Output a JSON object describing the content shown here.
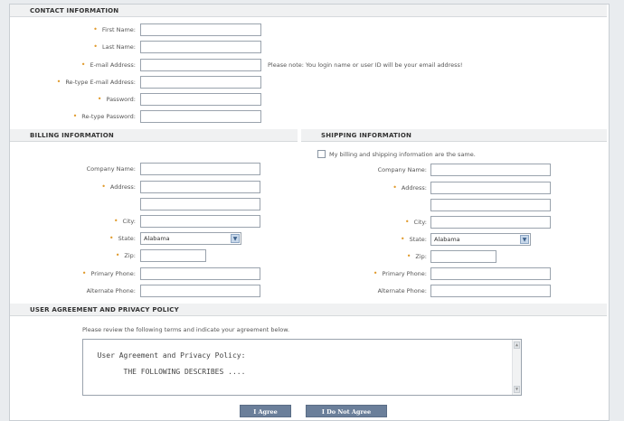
{
  "contact": {
    "header": "CONTACT INFORMATION",
    "first_name": "First Name:",
    "last_name": "Last Name:",
    "email": "E-mail Address:",
    "retype_email": "Re-type E-mail Address:",
    "password": "Password:",
    "retype_password": "Re-type Password:",
    "email_note": "Please note: You login name or user ID will be your email address!"
  },
  "billing": {
    "header": "BILLING INFORMATION",
    "company": "Company Name:",
    "address": "Address:",
    "city": "City:",
    "state": "State:",
    "state_value": "Alabama",
    "zip": "Zip:",
    "primary_phone": "Primary Phone:",
    "alternate_phone": "Alternate Phone:"
  },
  "shipping": {
    "header": "SHIPPING INFORMATION",
    "same_label": "My billing and shipping information are the same.",
    "company": "Company Name:",
    "address": "Address:",
    "city": "City:",
    "state": "State:",
    "state_value": "Alabama",
    "zip": "Zip:",
    "primary_phone": "Primary Phone:",
    "alternate_phone": "Alternate Phone:"
  },
  "agreement": {
    "header": "USER AGREEMENT AND PRIVACY POLICY",
    "instructions": "Please review the following terms and indicate your agreement below.",
    "text": "User Agreement and Privacy Policy:\n\n        THE FOLLOWING DESCRIBES ....",
    "agree_label": "I Agree",
    "disagree_label": "I Do Not Agree"
  },
  "colors": {
    "required_marker": "#e09a2c",
    "button_bg": "#6b7f9a",
    "header_bg": "#f0f1f2"
  },
  "required_marker": "•",
  "select_arrow_icon": "chevron-down-icon"
}
